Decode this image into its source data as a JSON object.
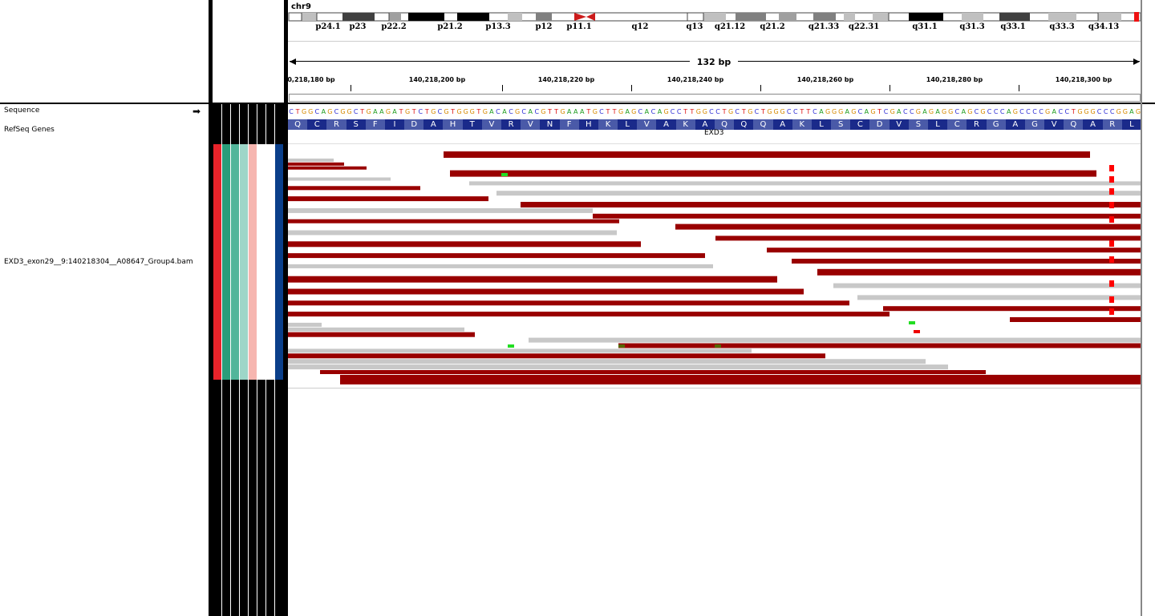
{
  "chromosome": "chr9",
  "span": "132 bp",
  "bands": [
    {
      "label": "p24.1"
    },
    {
      "label": "p23"
    },
    {
      "label": "p22.2"
    },
    {
      "label": "p21.2"
    },
    {
      "label": "p13.3"
    },
    {
      "label": "p12"
    },
    {
      "label": "p11.1"
    },
    {
      "label": "q12"
    },
    {
      "label": "q13"
    },
    {
      "label": "q21.12"
    },
    {
      "label": "q21.2"
    },
    {
      "label": "q21.33"
    },
    {
      "label": "q22.31"
    },
    {
      "label": "q31.1"
    },
    {
      "label": "q31.3"
    },
    {
      "label": "q33.1"
    },
    {
      "label": "q33.3"
    },
    {
      "label": "q34.13"
    }
  ],
  "ruler_ticks": [
    "0,218,180 bp",
    "140,218,200 bp",
    "140,218,220 bp",
    "140,218,240 bp",
    "140,218,260 bp",
    "140,218,280 bp",
    "140,218,300 bp"
  ],
  "tracks": {
    "sequence": "Sequence",
    "refseq": "RefSeq Genes",
    "bam": "EXD3_exon29__9:140218304__A08647_Group4.bam"
  },
  "sequence_string": "CTGGCAGCGGCTGAAGATGTCTGCGTGGGTGACACGCACGTTGAAATGCTTGAGCACAGCCTTGGCCTGCTGCTGGGCCTTCAGGGAGCAGTCGACCGAGAGGCAGCGCCCAGCCCCGACCTGGGCCCGGAG",
  "amino_acids": [
    "Q",
    "C",
    "R",
    "S",
    "F",
    "I",
    "D",
    "A",
    "H",
    "T",
    "V",
    "R",
    "V",
    "N",
    "F",
    "H",
    "K",
    "L",
    "V",
    "A",
    "K",
    "A",
    "Q",
    "Q",
    "Q",
    "A",
    "K",
    "L",
    "S",
    "C",
    "D",
    "V",
    "S",
    "L",
    "C",
    "R",
    "G",
    "A",
    "G",
    "V",
    "Q",
    "A",
    "R",
    "L"
  ],
  "gene_name": "EXD3",
  "colors": {
    "read_red": "#990000",
    "read_gray": "#c8c8c8",
    "aa_dark": "#1a2a8a",
    "attr": [
      "#e8232a",
      "#2a9d7a",
      "#52b59a",
      "#9ed6c8",
      "#f6b6b0",
      "#ffffff",
      "#ffffff",
      "#0b3f8a"
    ]
  }
}
